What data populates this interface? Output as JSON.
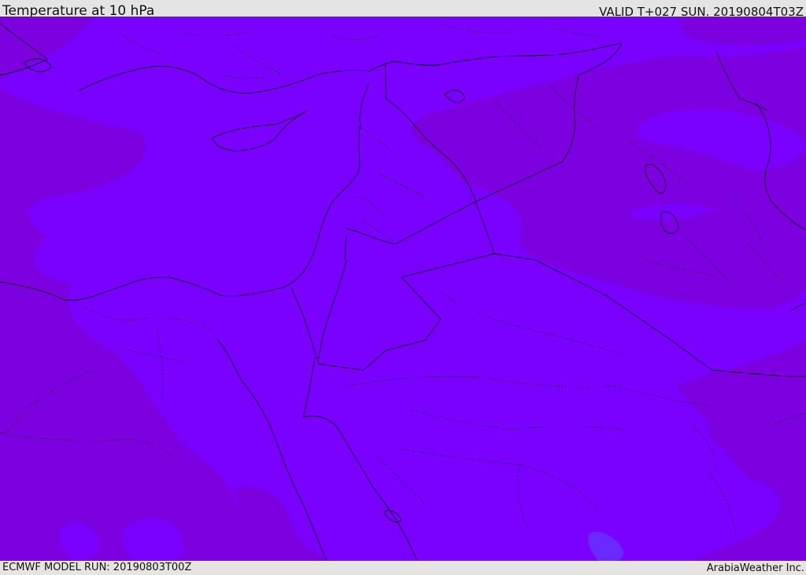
{
  "header": {
    "title": "Temperature at 10 hPa",
    "valid_time": "VALID T+027 SUN. 20190804T03Z"
  },
  "footer": {
    "model_run": "ECMWF MODEL RUN: 20190803T00Z",
    "credit": "ArabiaWeather Inc."
  },
  "map": {
    "colors": {
      "base_field": "#7a00ff",
      "warmer_field": "#7d00e0",
      "cool_spot": "#6a2aff",
      "boundary_lines": "#1a0030",
      "frame_background": "#e4e4e4"
    }
  }
}
